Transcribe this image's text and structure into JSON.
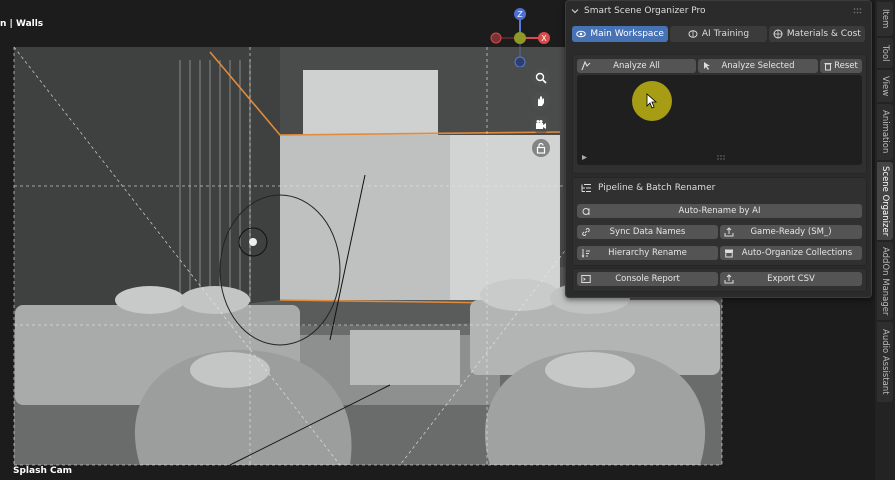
{
  "viewport": {
    "top_label": "n | Walls",
    "bottom_label": "Splash Cam",
    "gizmo": {
      "z_label": "Z",
      "x_label": "X"
    }
  },
  "panel": {
    "title": "Smart Scene Organizer Pro",
    "tabs": [
      {
        "label": "Main Workspace",
        "icon": "eye-icon",
        "active": true
      },
      {
        "label": "AI Training",
        "icon": "brain-icon",
        "active": false
      },
      {
        "label": "Materials & Cost",
        "icon": "shader-icon",
        "active": false
      }
    ],
    "analyze": {
      "analyze_all": "Analyze All",
      "analyze_selected": "Analyze Selected",
      "reset": "Reset"
    },
    "renamer": {
      "title": "Pipeline & Batch Renamer",
      "auto_rename": "Auto-Rename by AI",
      "sync_data_names": "Sync Data Names",
      "game_ready": "Game-Ready (SM_)",
      "hierarchy_rename": "Hierarchy Rename",
      "auto_organize": "Auto-Organize Collections"
    },
    "report": {
      "console_report": "Console Report",
      "export_csv": "Export CSV"
    }
  },
  "sidebar_tabs": [
    "Item",
    "Tool",
    "View",
    "Animation",
    "Scene Organizer",
    "AddOn Manager",
    "Audio Assistant"
  ],
  "colors": {
    "accent": "#4772b3",
    "panel_bg": "#2b2b2b",
    "button": "#545454",
    "cursor_highlight": "#beb414"
  }
}
